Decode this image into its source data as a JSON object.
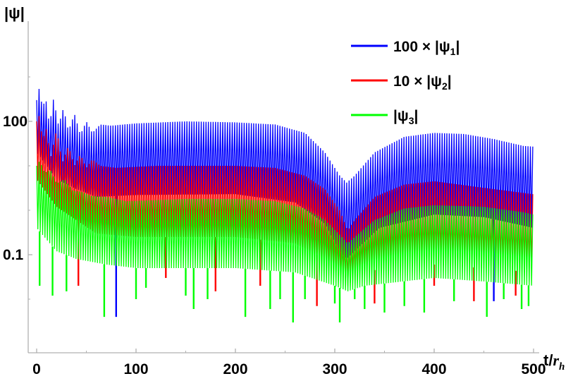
{
  "chart_data": {
    "type": "line",
    "xlabel": "t/r_h",
    "xlabel_main": "t/",
    "xlabel_var": "r",
    "xlabel_sub": "h",
    "ylabel": "|ψ|",
    "yscale": "log",
    "xlim": [
      0,
      510
    ],
    "ylim": [
      0.003,
      2000
    ],
    "x_ticks": [
      0,
      100,
      200,
      300,
      400,
      500
    ],
    "x_tick_labels": [
      "0",
      "100",
      "200",
      "300",
      "400",
      "500"
    ],
    "y_ticks": [
      100,
      0.1
    ],
    "y_tick_labels": [
      "100",
      "0.1"
    ],
    "oscillation_period": 2.4,
    "series": [
      {
        "name": "100 × |ψ1|",
        "legend_main": "100 × |ψ",
        "legend_sub": "1",
        "legend_end": "|",
        "color": "#0000ff",
        "upper_envelope": [
          [
            0,
            300
          ],
          [
            2,
            600
          ],
          [
            6,
            200
          ],
          [
            9,
            350
          ],
          [
            13,
            80
          ],
          [
            17,
            330
          ],
          [
            22,
            80
          ],
          [
            27,
            200
          ],
          [
            32,
            60
          ],
          [
            38,
            150
          ],
          [
            44,
            50
          ],
          [
            50,
            100
          ],
          [
            56,
            55
          ],
          [
            64,
            85
          ],
          [
            75,
            80
          ],
          [
            100,
            90
          ],
          [
            150,
            100
          ],
          [
            200,
            95
          ],
          [
            240,
            85
          ],
          [
            270,
            55
          ],
          [
            290,
            20
          ],
          [
            305,
            6
          ],
          [
            312,
            4.2
          ],
          [
            320,
            6
          ],
          [
            340,
            20
          ],
          [
            370,
            45
          ],
          [
            400,
            55
          ],
          [
            430,
            52
          ],
          [
            460,
            40
          ],
          [
            490,
            28
          ],
          [
            500,
            27
          ]
        ],
        "lower_envelope": [
          [
            0,
            20
          ],
          [
            20,
            5
          ],
          [
            40,
            3
          ],
          [
            60,
            2
          ],
          [
            100,
            2.2
          ],
          [
            200,
            2.3
          ],
          [
            260,
            1.5
          ],
          [
            290,
            0.5
          ],
          [
            305,
            0.12
          ],
          [
            312,
            0.08
          ],
          [
            320,
            0.12
          ],
          [
            345,
            0.4
          ],
          [
            400,
            0.8
          ],
          [
            450,
            0.7
          ],
          [
            500,
            0.4
          ]
        ],
        "dips": [
          [
            80,
            0.004
          ],
          [
            460,
            0.009
          ]
        ]
      },
      {
        "name": "10 × |ψ2|",
        "legend_main": "10 × |ψ",
        "legend_sub": "2",
        "legend_end": "|",
        "color": "#ff0000",
        "upper_envelope": [
          [
            0,
            100
          ],
          [
            2,
            150
          ],
          [
            6,
            40
          ],
          [
            10,
            70
          ],
          [
            14,
            15
          ],
          [
            20,
            65
          ],
          [
            26,
            12
          ],
          [
            32,
            28
          ],
          [
            38,
            10
          ],
          [
            44,
            18
          ],
          [
            50,
            9
          ],
          [
            56,
            14
          ],
          [
            64,
            10
          ],
          [
            80,
            9
          ],
          [
            120,
            10
          ],
          [
            200,
            10
          ],
          [
            240,
            9
          ],
          [
            270,
            6
          ],
          [
            290,
            3
          ],
          [
            305,
            1
          ],
          [
            313,
            0.35
          ],
          [
            320,
            0.6
          ],
          [
            340,
            2
          ],
          [
            370,
            3.8
          ],
          [
            400,
            4.5
          ],
          [
            450,
            3.2
          ],
          [
            500,
            2.3
          ]
        ],
        "lower_envelope": [
          [
            0,
            5
          ],
          [
            20,
            1.2
          ],
          [
            40,
            0.6
          ],
          [
            60,
            0.3
          ],
          [
            100,
            0.25
          ],
          [
            200,
            0.25
          ],
          [
            260,
            0.18
          ],
          [
            290,
            0.08
          ],
          [
            305,
            0.03
          ],
          [
            313,
            0.02
          ],
          [
            320,
            0.03
          ],
          [
            345,
            0.05
          ],
          [
            400,
            0.06
          ],
          [
            450,
            0.05
          ],
          [
            500,
            0.04
          ]
        ],
        "dips": [
          [
            42,
            0.02
          ],
          [
            130,
            0.03
          ],
          [
            180,
            0.015
          ],
          [
            225,
            0.02
          ],
          [
            282,
            0.007
          ],
          [
            340,
            0.008
          ],
          [
            400,
            0.02
          ],
          [
            440,
            0.009
          ],
          [
            482,
            0.012
          ]
        ]
      },
      {
        "name": "|ψ3|",
        "legend_main": "|ψ",
        "legend_sub": "3",
        "legend_end": "|",
        "color": "#00ff00",
        "upper_envelope": [
          [
            0,
            10
          ],
          [
            3,
            13
          ],
          [
            8,
            7
          ],
          [
            14,
            8
          ],
          [
            20,
            4
          ],
          [
            28,
            5
          ],
          [
            36,
            2.8
          ],
          [
            45,
            2.6
          ],
          [
            55,
            2.1
          ],
          [
            70,
            2
          ],
          [
            90,
            1.6
          ],
          [
            150,
            1.8
          ],
          [
            200,
            1.8
          ],
          [
            240,
            1.6
          ],
          [
            270,
            1.1
          ],
          [
            290,
            0.6
          ],
          [
            305,
            0.28
          ],
          [
            313,
            0.18
          ],
          [
            320,
            0.25
          ],
          [
            340,
            0.6
          ],
          [
            370,
            1.1
          ],
          [
            400,
            1.3
          ],
          [
            450,
            1.2
          ],
          [
            490,
            0.9
          ],
          [
            500,
            0.8
          ]
        ],
        "lower_envelope": [
          [
            0,
            0.4
          ],
          [
            20,
            0.12
          ],
          [
            40,
            0.08
          ],
          [
            70,
            0.06
          ],
          [
            100,
            0.05
          ],
          [
            200,
            0.05
          ],
          [
            260,
            0.04
          ],
          [
            300,
            0.02
          ],
          [
            313,
            0.015
          ],
          [
            330,
            0.02
          ],
          [
            400,
            0.03
          ],
          [
            450,
            0.025
          ],
          [
            500,
            0.02
          ]
        ],
        "dips": [
          [
            3,
            0.02
          ],
          [
            16,
            0.012
          ],
          [
            30,
            0.015
          ],
          [
            68,
            0.004
          ],
          [
            100,
            0.01
          ],
          [
            110,
            0.018
          ],
          [
            150,
            0.012
          ],
          [
            158,
            0.006
          ],
          [
            172,
            0.01
          ],
          [
            210,
            0.004
          ],
          [
            235,
            0.006
          ],
          [
            245,
            0.01
          ],
          [
            258,
            0.003
          ],
          [
            270,
            0.01
          ],
          [
            300,
            0.008
          ],
          [
            305,
            0.003
          ],
          [
            320,
            0.01
          ],
          [
            330,
            0.006
          ],
          [
            350,
            0.005
          ],
          [
            370,
            0.007
          ],
          [
            390,
            0.005
          ],
          [
            420,
            0.009
          ],
          [
            453,
            0.004
          ],
          [
            470,
            0.01
          ],
          [
            488,
            0.006
          ],
          [
            495,
            0.007
          ]
        ]
      }
    ]
  }
}
